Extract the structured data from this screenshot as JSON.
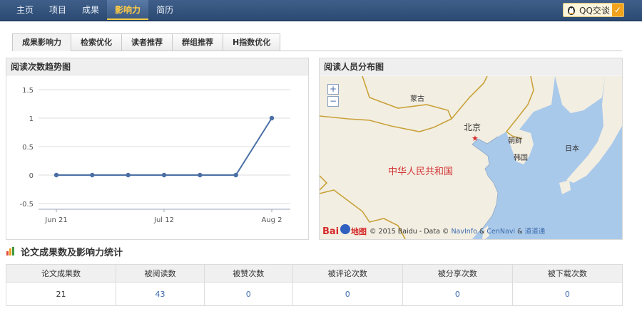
{
  "nav": {
    "items": [
      "主页",
      "项目",
      "成果",
      "影响力",
      "简历"
    ],
    "active_index": 3
  },
  "qq": {
    "label": "QQ交谈"
  },
  "subtabs": {
    "items": [
      "成果影响力",
      "检索优化",
      "读者推荐",
      "群组推荐",
      "H指数优化"
    ],
    "active_index": 0
  },
  "trend": {
    "title": "阅读次数趋势图",
    "chart_data": {
      "type": "line",
      "categories": [
        "Jun 21",
        "",
        "",
        "Jul 12",
        "",
        "",
        "Aug 2"
      ],
      "x_tick_labels": [
        "Jun 21",
        "Jul 12",
        "Aug 2"
      ],
      "values": [
        0,
        0,
        0,
        0,
        0,
        0,
        1
      ],
      "y_ticks": [
        -0.5,
        0,
        0.5,
        1,
        1.5
      ],
      "ylim": [
        -0.5,
        1.5
      ],
      "grid": true,
      "series_color": "#4a6fa5"
    }
  },
  "distribution": {
    "title": "阅读人员分布图",
    "map_labels": {
      "mongolia": "蒙古",
      "beijing": "北京",
      "china": "中华人民共和国",
      "north_korea": "朝鲜",
      "south_korea": "韩国",
      "japan": "日本"
    },
    "zoom_in": "+",
    "zoom_out": "−",
    "baidu_logo": "Bai地图",
    "attribution_prefix": "© 2015 Baidu - Data © ",
    "attribution_navinfo": "NavInfo",
    "attribution_amp": " & ",
    "attribution_cennavi": "CenNavi",
    "attribution_amp2": " & ",
    "attribution_ddt": "道道通"
  },
  "stats": {
    "title": "论文成果数及影响力统计",
    "headers": [
      "论文成果数",
      "被阅读数",
      "被赞次数",
      "被评论次数",
      "被分享次数",
      "被下载次数"
    ],
    "values": [
      "21",
      "43",
      "0",
      "0",
      "0",
      "0"
    ]
  },
  "colors": {
    "accent": "#2c4a72",
    "link": "#3d6cad",
    "active_nav": "#ffcc44"
  }
}
